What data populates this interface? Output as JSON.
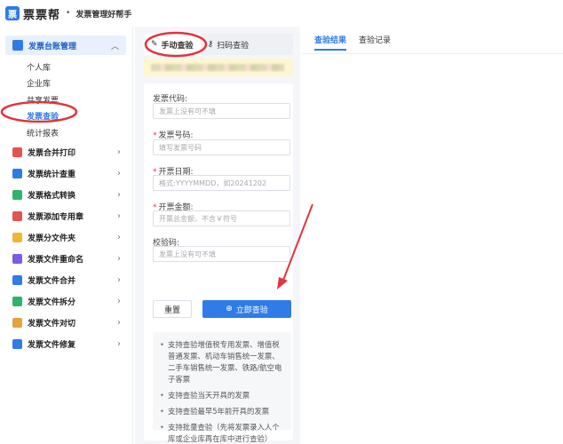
{
  "header": {
    "logo_char": "票",
    "app_name": "票票帮",
    "separator": "•",
    "tagline": "发票管理好帮手"
  },
  "sidebar": {
    "group": {
      "label": "发票台账管理",
      "expanded": true
    },
    "sub_items": [
      {
        "label": "个人库",
        "active": false
      },
      {
        "label": "企业库",
        "active": false
      },
      {
        "label": "共享发票",
        "active": false
      },
      {
        "label": "发票查验",
        "active": true
      },
      {
        "label": "统计报表",
        "active": false
      }
    ],
    "items": [
      {
        "label": "发票合并打印",
        "icon": "printer-icon",
        "color": "#e5534b"
      },
      {
        "label": "发票统计查重",
        "icon": "chart-icon",
        "color": "#2f7be8"
      },
      {
        "label": "发票格式转换",
        "icon": "swap-icon",
        "color": "#2fb36b"
      },
      {
        "label": "发票添加专用章",
        "icon": "stamp-icon",
        "color": "#e5534b"
      },
      {
        "label": "发票分文件夹",
        "icon": "folder-icon",
        "color": "#f2b531"
      },
      {
        "label": "发票文件重命名",
        "icon": "rename-icon",
        "color": "#7b5be8"
      },
      {
        "label": "发票文件合并",
        "icon": "merge-icon",
        "color": "#2f7be8"
      },
      {
        "label": "发票文件拆分",
        "icon": "split-icon",
        "color": "#2fb36b"
      },
      {
        "label": "发票文件对切",
        "icon": "cut-icon",
        "color": "#e6a23c"
      },
      {
        "label": "发票文件修复",
        "icon": "wrench-icon",
        "color": "#2f7be8"
      }
    ]
  },
  "tabs": {
    "manual": "手动查验",
    "scan": "扫码查验"
  },
  "form": {
    "fields": [
      {
        "label": "发票代码:",
        "required": false,
        "placeholder": "发票上没有可不填"
      },
      {
        "label": "发票号码:",
        "required": true,
        "placeholder": "填写发票号码"
      },
      {
        "label": "开票日期:",
        "required": true,
        "placeholder": "格式:YYYYMMDD，如20241202"
      },
      {
        "label": "开票金额:",
        "required": true,
        "placeholder": "开票总金额，不含￥符号"
      },
      {
        "label": "校验码:",
        "required": false,
        "placeholder": "发票上没有可不填"
      }
    ],
    "reset_label": "重置",
    "query_label": "立即查验"
  },
  "tips": [
    "支持查验增值税专用发票、增值税普通发票、机动车销售统一发票、二手车销售统一发票、铁路/航空电子客票",
    "支持查验当天开具的发票",
    "支持查验最早5年前开具的发票",
    "支持批量查验（先将发票录入人个库或企业库再在库中进行查验）"
  ],
  "right_tabs": {
    "result": "查验结果",
    "history": "查验记录"
  },
  "colors": {
    "accent": "#2f7be8",
    "annotation": "#e0353d",
    "required": "#e23b3b"
  }
}
